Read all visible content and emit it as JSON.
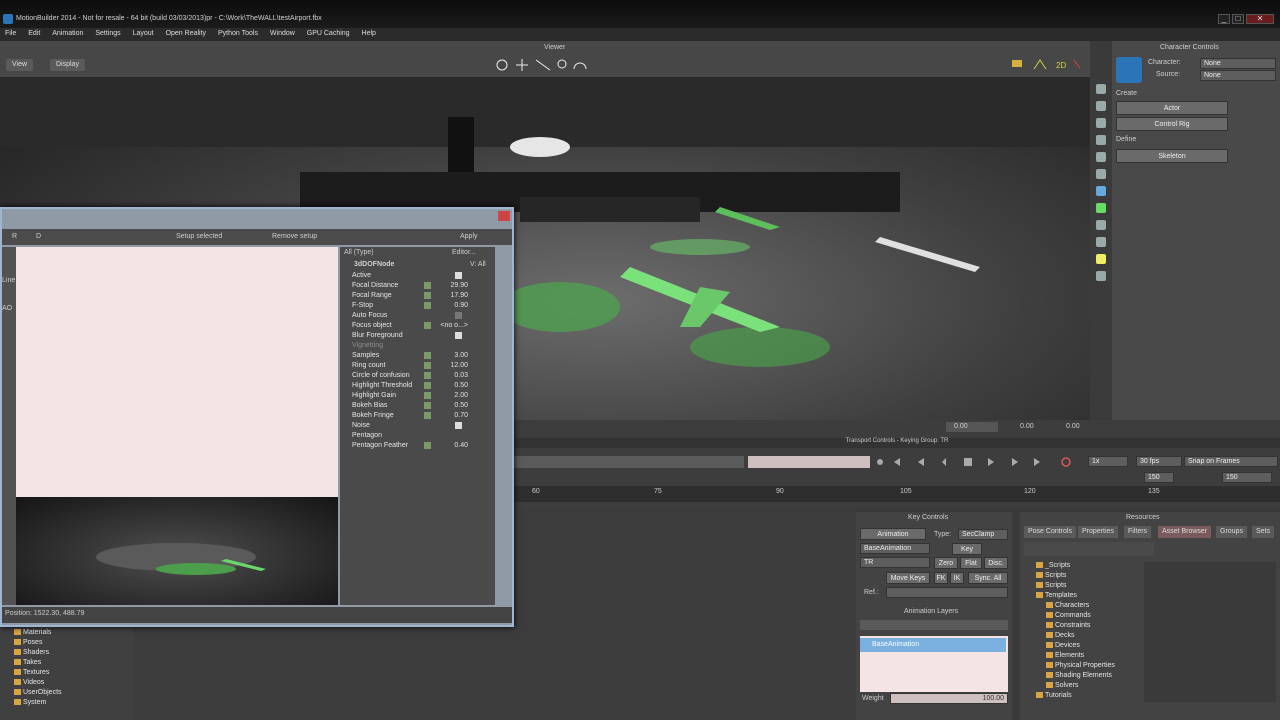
{
  "titlebar": {
    "title": "MotionBuilder 2014 - Not for resale - 64 bit (build 03/03/2013)pr - C:\\Work\\TheWALL\\testAirport.fbx",
    "minimize": "_",
    "maximize": "□",
    "close": "✕"
  },
  "menu": [
    "File",
    "Edit",
    "Animation",
    "Settings",
    "Layout",
    "Open Reality",
    "Python Tools",
    "Window",
    "GPU Caching",
    "Help"
  ],
  "viewer": {
    "title": "Viewer",
    "view_btn": "View",
    "display_btn": "Display"
  },
  "character_controls": {
    "title": "Character Controls",
    "character_label": "Character:",
    "character_value": "None",
    "source_label": "Source:",
    "source_value": "None",
    "create_label": "Create",
    "actor_btn": "Actor",
    "control_rig_btn": "Control Rig",
    "define_label": "Define",
    "skeleton_btn": "Skeleton"
  },
  "dof_dialog": {
    "tab_r": "R",
    "tab_d": "D",
    "setup_selected": "Setup selected",
    "remove_setup": "Remove setup",
    "apply": "Apply",
    "all_type": "All (Type)",
    "editor": "Editor...",
    "node": "3dDOFNode",
    "v_all": "V: All",
    "props": [
      {
        "name": "Active",
        "val": "",
        "chk": true
      },
      {
        "name": "Focal Distance",
        "val": "29.90"
      },
      {
        "name": "Focal Range",
        "val": "17.90"
      },
      {
        "name": "F-Stop",
        "val": "0.90"
      },
      {
        "name": "Auto Focus",
        "val": "",
        "chk": false
      },
      {
        "name": "Focus object",
        "val": "<no o...>"
      },
      {
        "name": "Blur Foreground",
        "val": "",
        "chk": true
      },
      {
        "name": "Vignetting",
        "val": "",
        "dim": true
      },
      {
        "name": "Samples",
        "val": "3.00"
      },
      {
        "name": "Ring count",
        "val": "12.00"
      },
      {
        "name": "Circle of confusion",
        "val": "0.03"
      },
      {
        "name": "Highlight Threshold",
        "val": "0.50"
      },
      {
        "name": "Highlight Gain",
        "val": "2.00"
      },
      {
        "name": "Bokeh Bias",
        "val": "0.50"
      },
      {
        "name": "Bokeh Fringe",
        "val": "0.70"
      },
      {
        "name": "Noise",
        "val": "",
        "chk": true
      },
      {
        "name": "Pentagon",
        "val": ""
      },
      {
        "name": "Pentagon Feather",
        "val": "0.40"
      }
    ],
    "status": "Position: 1522.30, 488.79",
    "side_labels": [
      "Line",
      "AO"
    ]
  },
  "transport": {
    "title": "Transport Controls - Keying Group: TR",
    "speed": "1x",
    "fps": "30 fps",
    "snap": "Snap on Frames",
    "end_frame": "150",
    "end_frame2": "150",
    "ticks": [
      "60",
      "75",
      "90",
      "105",
      "120",
      "135"
    ],
    "viewer_coords": [
      "0.00",
      "0.00",
      "0.00"
    ]
  },
  "key_controls": {
    "title": "Key Controls",
    "animation": "Animation",
    "type_label": "Type:",
    "type_value": "SecClamp",
    "base_animation": "BaseAnimation",
    "key": "Key",
    "tr": "TR",
    "zero": "Zero",
    "flat": "Flat",
    "disc": "Disc.",
    "move_keys": "Move Keys",
    "fk": "FK",
    "ik": "IK",
    "sync_all": "Sync. All",
    "ref_label": "Ref.:",
    "layers_title": "Animation Layers",
    "layer_name": "BaseAnimation",
    "weight_label": "Weight",
    "weight_value": "100.00"
  },
  "resources": {
    "title": "Resources",
    "tabs": [
      "Pose Controls",
      "Properties",
      "Filters",
      "Asset Browser",
      "Groups",
      "Sets"
    ],
    "tree": [
      "_Scripts",
      "Scripts",
      "Scripts",
      "Templates",
      "Characters",
      "Commands",
      "Constraints",
      "Decks",
      "Devices",
      "Elements",
      "Physical Properties",
      "Shading Elements",
      "Solvers",
      "Tutorials"
    ]
  },
  "navigator": {
    "items": [
      "Materials",
      "Poses",
      "Shaders",
      "Takes",
      "Textures",
      "Videos",
      "UserObjects",
      "System"
    ]
  },
  "colors": {
    "accent": "#2b74b8",
    "green_light": "#5dff5d",
    "asset_tab": "#7a5a5a"
  }
}
